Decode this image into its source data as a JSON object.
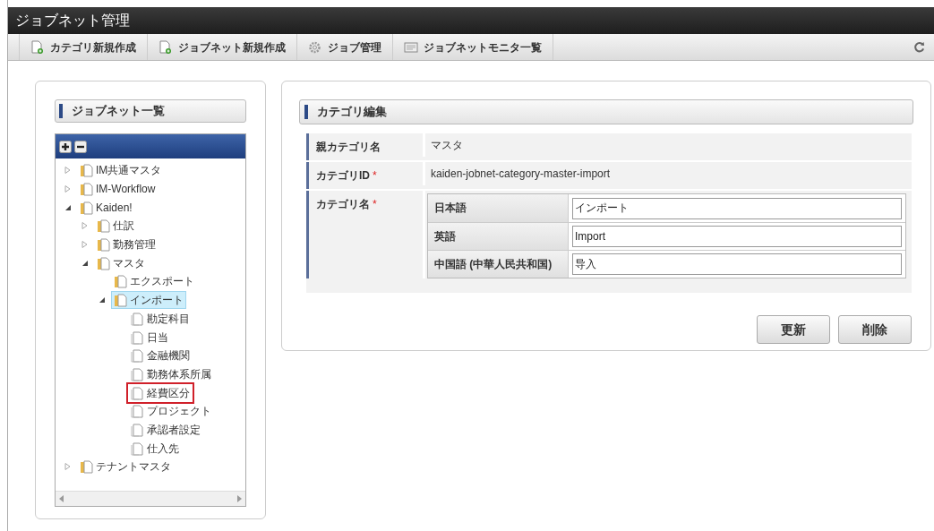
{
  "window": {
    "title": "ジョブネット管理"
  },
  "toolbar": {
    "items": [
      {
        "label": "カテゴリ新規作成",
        "kind": "new-doc"
      },
      {
        "label": "ジョブネット新規作成",
        "kind": "new-doc"
      },
      {
        "label": "ジョブ管理",
        "kind": "gear"
      },
      {
        "label": "ジョブネットモニタ一覧",
        "kind": "monitor"
      }
    ]
  },
  "sidebar": {
    "title": "ジョブネット一覧",
    "tree": [
      {
        "label": "IM共通マスタ",
        "kind": "folder",
        "expanded": false,
        "selected": false,
        "marked": false
      },
      {
        "label": "IM-Workflow",
        "kind": "folder",
        "expanded": false,
        "selected": false,
        "marked": false
      },
      {
        "label": "Kaiden!",
        "kind": "folder",
        "expanded": true,
        "selected": false,
        "marked": false,
        "children": [
          {
            "label": "仕訳",
            "kind": "folder",
            "expanded": false,
            "selected": false,
            "marked": false
          },
          {
            "label": "勤務管理",
            "kind": "folder",
            "expanded": false,
            "selected": false,
            "marked": false
          },
          {
            "label": "マスタ",
            "kind": "folder",
            "expanded": true,
            "selected": false,
            "marked": false,
            "children": [
              {
                "label": "エクスポート",
                "kind": "folder",
                "selected": false,
                "marked": false
              },
              {
                "label": "インポート",
                "kind": "folder",
                "expanded": true,
                "selected": true,
                "marked": false,
                "children": [
                  {
                    "label": "勘定科目",
                    "kind": "file",
                    "selected": false,
                    "marked": false
                  },
                  {
                    "label": "日当",
                    "kind": "file",
                    "selected": false,
                    "marked": false
                  },
                  {
                    "label": "金融機関",
                    "kind": "file",
                    "selected": false,
                    "marked": false
                  },
                  {
                    "label": "勤務体系所属",
                    "kind": "file",
                    "selected": false,
                    "marked": false
                  },
                  {
                    "label": "経費区分",
                    "kind": "file",
                    "selected": false,
                    "marked": true
                  },
                  {
                    "label": "プロジェクト",
                    "kind": "file",
                    "selected": false,
                    "marked": false
                  },
                  {
                    "label": "承認者設定",
                    "kind": "file",
                    "selected": false,
                    "marked": false
                  },
                  {
                    "label": "仕入先",
                    "kind": "file",
                    "selected": false,
                    "marked": false
                  }
                ]
              }
            ]
          }
        ]
      },
      {
        "label": "テナントマスタ",
        "kind": "folder",
        "expanded": false,
        "selected": false,
        "marked": false
      }
    ]
  },
  "form": {
    "title": "カテゴリ編集",
    "rows": [
      {
        "label": "親カテゴリ名",
        "value": "マスタ"
      },
      {
        "label": "カテゴリID",
        "required_mark": "*",
        "value": "kaiden-jobnet-category-master-import"
      },
      {
        "label": "カテゴリ名",
        "required_mark": "*",
        "locales": [
          {
            "language": "日本語",
            "value": "インポート"
          },
          {
            "language": "英語",
            "value": "Import"
          },
          {
            "language": "中国語 (中華人民共和国)",
            "value": "导入"
          }
        ]
      }
    ],
    "buttons": [
      "更新",
      "削除"
    ]
  }
}
